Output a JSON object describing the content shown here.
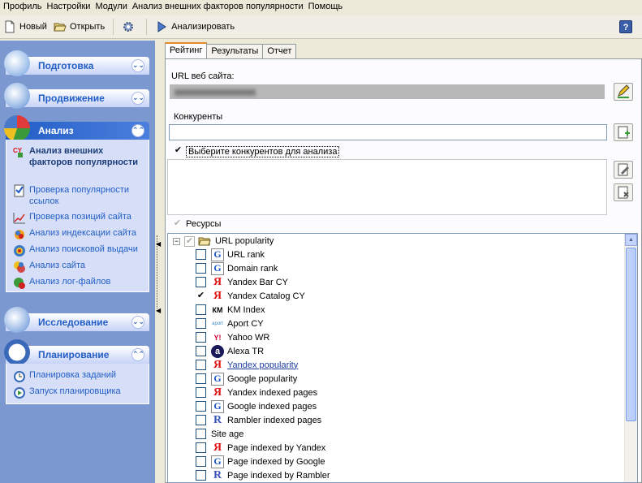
{
  "menu": [
    "Профиль",
    "Настройки",
    "Модули",
    "Анализ внешних факторов популярности",
    "Помощь"
  ],
  "toolbar": {
    "new_label": "Новый",
    "open_label": "Открыть",
    "analyze_label": "Анализировать",
    "help_glyph": "?"
  },
  "sidebar": {
    "groups": {
      "prep": {
        "title": "Подготовка",
        "chevron": "⌄⌄"
      },
      "promo": {
        "title": "Продвижение",
        "chevron": "⌄⌄"
      },
      "analysis": {
        "title": "Анализ",
        "chevron": "⌃⌃",
        "items": [
          "Анализ внешних факторов популярности",
          "Проверка популярности ссылок",
          "Проверка позиций сайта",
          "Анализ индексации сайта",
          "Анализ поисковой выдачи",
          "Анализ сайта",
          "Анализ лог-файлов"
        ]
      },
      "research": {
        "title": "Исследование",
        "chevron": "⌄⌄"
      },
      "planning": {
        "title": "Планирование",
        "chevron": "⌃⌃",
        "items": [
          "Планировка заданий",
          "Запуск планировщика"
        ]
      }
    }
  },
  "tabs": [
    "Рейтинг",
    "Результаты",
    "Отчет"
  ],
  "form": {
    "url_label": "URL веб сайта:",
    "competitors_label": "Конкуренты",
    "select_competitors_label": "Выберите конкурентов для анализа",
    "resources_label": "Ресурсы"
  },
  "tree": {
    "root_label": "URL popularity",
    "items": [
      {
        "label": "URL rank",
        "checked": "",
        "icon": "G"
      },
      {
        "label": "Domain rank",
        "checked": "",
        "icon": "G"
      },
      {
        "label": "Yandex Bar CY",
        "checked": "",
        "icon": "Я"
      },
      {
        "label": "Yandex Catalog CY",
        "checked": "✔",
        "icon": "Я"
      },
      {
        "label": "KM Index",
        "checked": "",
        "icon": "КМ"
      },
      {
        "label": "Aport CY",
        "checked": "",
        "icon": "aport"
      },
      {
        "label": "Yahoo WR",
        "checked": "",
        "icon": "Y!"
      },
      {
        "label": "Alexa TR",
        "checked": "",
        "icon": "a"
      },
      {
        "label": "Yandex popularity",
        "checked": "",
        "icon": "Я"
      },
      {
        "label": "Google popularity",
        "checked": "",
        "icon": "G"
      },
      {
        "label": "Yandex indexed pages",
        "checked": "",
        "icon": "Я"
      },
      {
        "label": "Google indexed pages",
        "checked": "",
        "icon": "G"
      },
      {
        "label": "Rambler indexed pages",
        "checked": "",
        "icon": "R"
      },
      {
        "label": "Site age",
        "checked": "",
        "icon": ""
      },
      {
        "label": "Page indexed by Yandex",
        "checked": "",
        "icon": "Я"
      },
      {
        "label": "Page indexed by Google",
        "checked": "",
        "icon": "G"
      },
      {
        "label": "Page indexed by Rambler",
        "checked": "",
        "icon": "R"
      }
    ]
  },
  "checks": {
    "select_competitors": "✔",
    "resources": "✔",
    "root": "✔"
  }
}
